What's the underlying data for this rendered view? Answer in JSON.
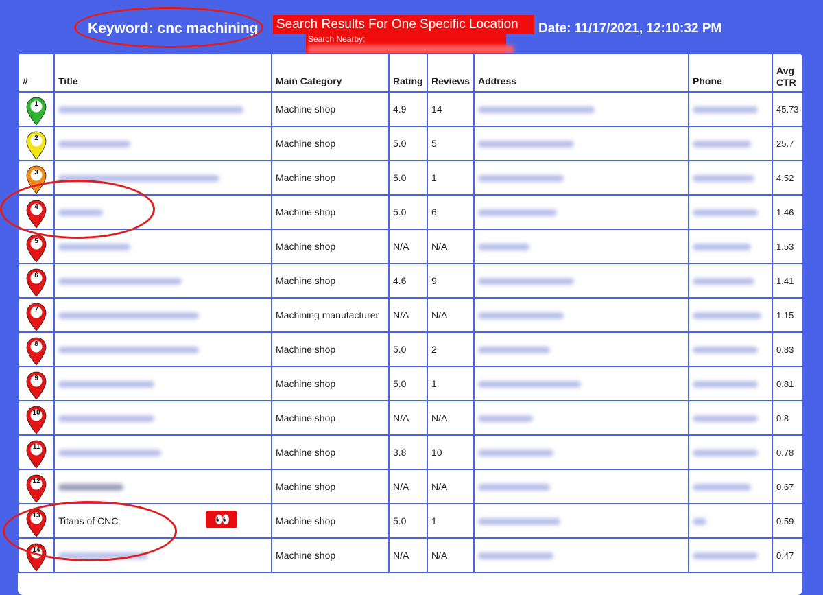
{
  "header": {
    "keyword": "Keyword: cnc machining",
    "banner": "Search Results For One Specific Location",
    "nearby_label": "Search Nearby:",
    "date": "Date: 11/17/2021, 12:10:32 PM"
  },
  "table": {
    "columns": [
      "#",
      "Title",
      "Main Category",
      "Rating",
      "Reviews",
      "Address",
      "Phone",
      "Avg CTR"
    ],
    "rows": [
      {
        "rank": "1",
        "title": "",
        "category": "Machine shop",
        "rating": "4.9",
        "reviews": "14",
        "ctr": "45.73",
        "pin_color": "#2fb52f"
      },
      {
        "rank": "2",
        "title": "",
        "category": "Machine shop",
        "rating": "5.0",
        "reviews": "5",
        "ctr": "25.7",
        "pin_color": "#f2e616"
      },
      {
        "rank": "3",
        "title": "",
        "category": "Machine shop",
        "rating": "5.0",
        "reviews": "1",
        "ctr": "4.52",
        "pin_color": "#f28a16"
      },
      {
        "rank": "4",
        "title": "",
        "category": "Machine shop",
        "rating": "5.0",
        "reviews": "6",
        "ctr": "1.46",
        "pin_color": "#e51515"
      },
      {
        "rank": "5",
        "title": "",
        "category": "Machine shop",
        "rating": "N/A",
        "reviews": "N/A",
        "ctr": "1.53",
        "pin_color": "#e51515"
      },
      {
        "rank": "6",
        "title": "",
        "category": "Machine shop",
        "rating": "4.6",
        "reviews": "9",
        "ctr": "1.41",
        "pin_color": "#e51515"
      },
      {
        "rank": "7",
        "title": "",
        "category": "Machining manufacturer",
        "rating": "N/A",
        "reviews": "N/A",
        "ctr": "1.15",
        "pin_color": "#e51515"
      },
      {
        "rank": "8",
        "title": "",
        "category": "Machine shop",
        "rating": "5.0",
        "reviews": "2",
        "ctr": "0.83",
        "pin_color": "#e51515"
      },
      {
        "rank": "9",
        "title": "",
        "category": "Machine shop",
        "rating": "5.0",
        "reviews": "1",
        "ctr": "0.81",
        "pin_color": "#e51515"
      },
      {
        "rank": "10",
        "title": "",
        "category": "Machine shop",
        "rating": "N/A",
        "reviews": "N/A",
        "ctr": "0.8",
        "pin_color": "#e51515"
      },
      {
        "rank": "11",
        "title": "",
        "category": "Machine shop",
        "rating": "3.8",
        "reviews": "10",
        "ctr": "0.78",
        "pin_color": "#e51515"
      },
      {
        "rank": "12",
        "title": "",
        "category": "Machine shop",
        "rating": "N/A",
        "reviews": "N/A",
        "ctr": "0.67",
        "pin_color": "#e51515"
      },
      {
        "rank": "13",
        "title": "Titans of CNC",
        "category": "Machine shop",
        "rating": "5.0",
        "reviews": "1",
        "ctr": "0.59",
        "pin_color": "#e51515"
      },
      {
        "rank": "14",
        "title": "",
        "category": "Machine shop",
        "rating": "N/A",
        "reviews": "N/A",
        "ctr": "0.47",
        "pin_color": "#e51515"
      }
    ]
  },
  "annotations": {
    "eyes_emoji": "👀"
  }
}
